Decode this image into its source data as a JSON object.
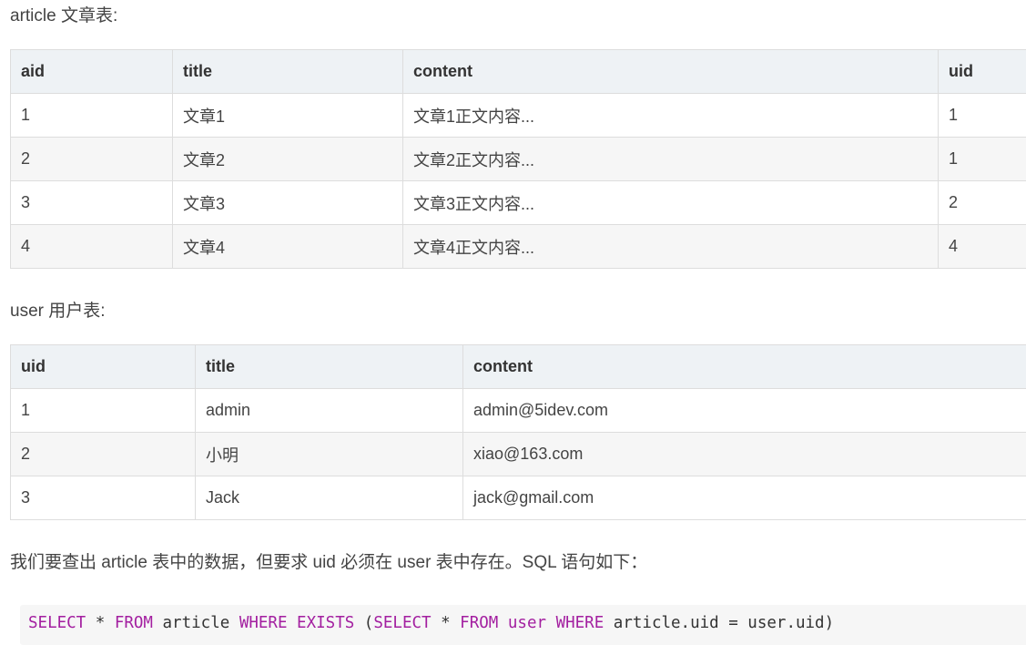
{
  "article_heading": "article 文章表:",
  "article_table": {
    "headers": [
      "aid",
      "title",
      "content",
      "uid"
    ],
    "rows": [
      [
        "1",
        "文章1",
        "文章1正文内容...",
        "1"
      ],
      [
        "2",
        "文章2",
        "文章2正文内容...",
        "1"
      ],
      [
        "3",
        "文章3",
        "文章3正文内容...",
        "2"
      ],
      [
        "4",
        "文章4",
        "文章4正文内容...",
        "4"
      ]
    ]
  },
  "user_heading": "user 用户表:",
  "user_table": {
    "headers": [
      "uid",
      "title",
      "content"
    ],
    "rows": [
      [
        "1",
        "admin",
        "admin@5idev.com"
      ],
      [
        "2",
        "小明",
        "xiao@163.com"
      ],
      [
        "3",
        "Jack",
        "jack@gmail.com"
      ]
    ]
  },
  "description": "我们要查出 article 表中的数据，但要求 uid 必须在 user 表中存在。SQL 语句如下：",
  "sql": {
    "tokens": [
      {
        "t": "SELECT",
        "k": "kw"
      },
      {
        "t": " * ",
        "k": "pl"
      },
      {
        "t": "FROM",
        "k": "kw"
      },
      {
        "t": " article ",
        "k": "pl"
      },
      {
        "t": "WHERE",
        "k": "kw"
      },
      {
        "t": " ",
        "k": "pl"
      },
      {
        "t": "EXISTS",
        "k": "kw"
      },
      {
        "t": " (",
        "k": "pl"
      },
      {
        "t": "SELECT",
        "k": "kw"
      },
      {
        "t": " * ",
        "k": "pl"
      },
      {
        "t": "FROM",
        "k": "kw"
      },
      {
        "t": " ",
        "k": "pl"
      },
      {
        "t": "user",
        "k": "kw"
      },
      {
        "t": " ",
        "k": "pl"
      },
      {
        "t": "WHERE",
        "k": "kw"
      },
      {
        "t": " article.uid = user.uid)",
        "k": "pl"
      }
    ]
  }
}
